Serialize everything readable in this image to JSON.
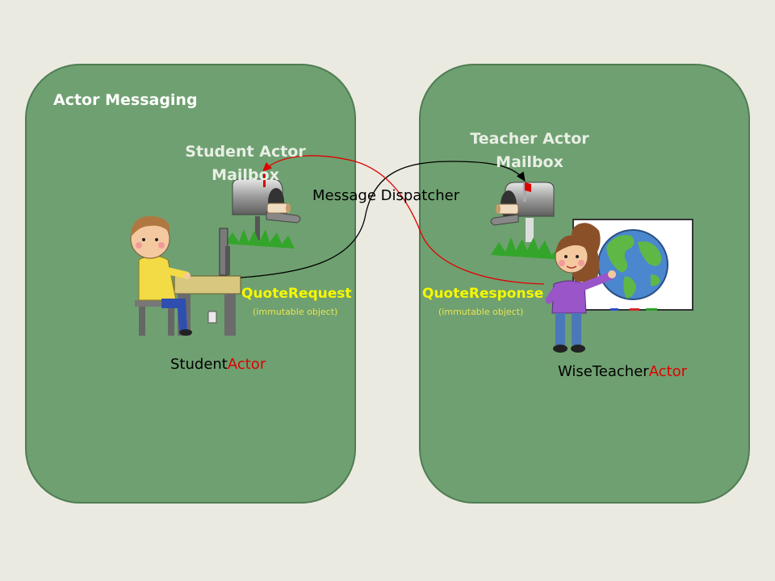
{
  "title": "Actor Messaging",
  "student_mailbox": {
    "line1": "Student Actor",
    "line2": "Mailbox"
  },
  "teacher_mailbox": {
    "line1": "Teacher Actor",
    "line2": "Mailbox"
  },
  "dispatcher": "Message Dispatcher",
  "quote_request": {
    "label": "QuoteRequest",
    "note": "(immutable object)"
  },
  "quote_response": {
    "label": "QuoteResponse",
    "note": "(immutable object)"
  },
  "student_actor": {
    "prefix": "Student",
    "suffix": "Actor"
  },
  "teacher_actor": {
    "prefix": "WiseTeacher",
    "suffix": "Actor"
  },
  "icons": [
    "student-mailbox-icon",
    "teacher-mailbox-icon",
    "student-at-computer-icon",
    "teacher-with-globe-icon",
    "globe-icon",
    "grass-icon"
  ],
  "colors": {
    "background": "#ebeae1",
    "panel": "#6fa071",
    "message_label": "#f7f700",
    "actor_accent": "#e00000",
    "request_arrow": "#000000",
    "response_arrow": "#e00000"
  }
}
